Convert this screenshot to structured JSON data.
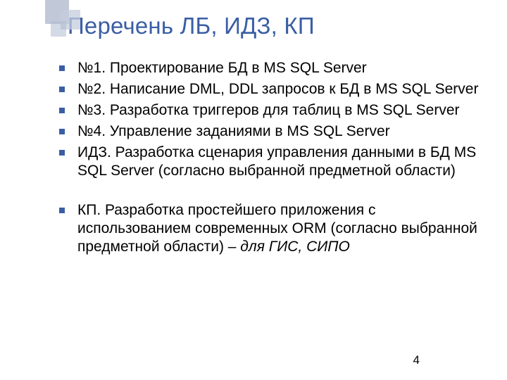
{
  "slide": {
    "title": "Перечень ЛБ, ИДЗ, КП",
    "bullets": [
      {
        "text": "№1. Проектирование БД в MS SQL Server"
      },
      {
        "text": "№2. Написание DML, DDL запросов к БД в MS SQL Server"
      },
      {
        "text": "№3. Разработка триггеров для таблиц в MS SQL Server"
      },
      {
        "text": "№4. Управление заданиями в MS SQL Server"
      },
      {
        "text": "ИДЗ. Разработка сценария управления данными в БД MS SQL Server (согласно выбранной предметной области)"
      },
      {
        "text": "КП. Разработка простейшего приложения с использованием современных ORM (согласно выбранной предметной области) – ",
        "italic_tail": "для ГИС, СИПО"
      }
    ],
    "page_number": "4"
  }
}
